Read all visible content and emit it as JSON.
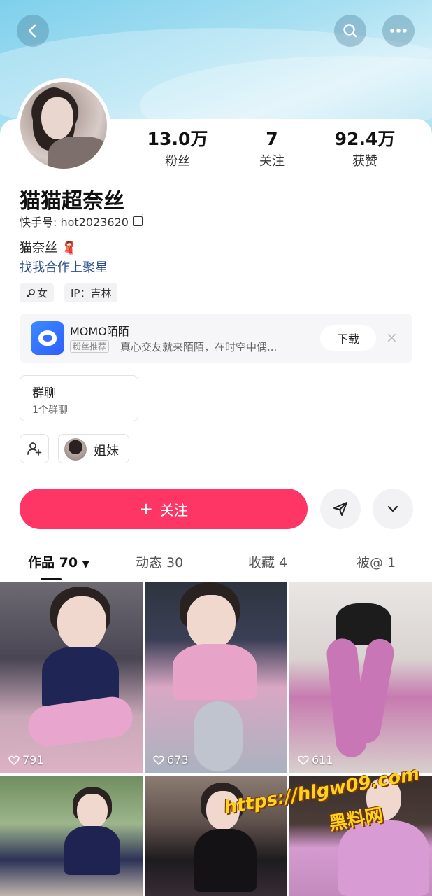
{
  "colors": {
    "accent": "#fe3666",
    "link": "#2c4f8c"
  },
  "header": {
    "back_icon": "back-arrow-icon",
    "search_icon": "search-icon",
    "more_icon": "more-dots-icon"
  },
  "profile": {
    "name": "猫猫超奈丝",
    "user_id": "快手号: hot2023620",
    "bio": "猫奈丝",
    "bio_emoji": "🧣",
    "link_text": "找我合作上聚星",
    "gender_tag": "女",
    "ip_tag": "IP：吉林"
  },
  "stats": [
    {
      "value": "13.0万",
      "label": "粉丝"
    },
    {
      "value": "7",
      "label": "关注"
    },
    {
      "value": "92.4万",
      "label": "获赞"
    }
  ],
  "promo": {
    "title": "MOMO陌陌",
    "badge": "粉丝推荐",
    "description": "真心交友就来陌陌，在时空中偶...",
    "download_label": "下载",
    "close_label": "×"
  },
  "group_chat": {
    "title": "群聊",
    "count": "1个群聊"
  },
  "relation": {
    "label": "姐妹"
  },
  "actions": {
    "follow_label": "关注",
    "follow_plus": "+"
  },
  "tabs": [
    {
      "label": "作品 70",
      "caret": "▼"
    },
    {
      "label": "动态 30"
    },
    {
      "label": "收藏 4"
    },
    {
      "label": "被@ 1"
    }
  ],
  "posts": [
    {
      "likes": "791"
    },
    {
      "likes": "673"
    },
    {
      "likes": "611"
    },
    {
      "likes": ""
    },
    {
      "likes": ""
    },
    {
      "likes": ""
    }
  ],
  "watermark": {
    "url": "https://hlgw09.com",
    "name": "黑料网"
  }
}
